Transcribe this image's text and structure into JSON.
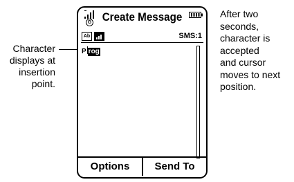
{
  "callouts": {
    "left": [
      "Character",
      "displays at",
      "insertion",
      "point."
    ],
    "right": [
      "After two",
      "seconds,",
      "character is",
      "accepted",
      "and cursor",
      "moves to next",
      "position."
    ]
  },
  "phone": {
    "title": "Create Message",
    "network_indicator": "G",
    "status": {
      "input_mode": "Ab",
      "sms_counter": "SMS:1"
    },
    "text": {
      "typed": "P",
      "suggestion": "rog"
    },
    "softkeys": {
      "left": "Options",
      "right": "Send To"
    }
  },
  "icons": [
    "signal-icon",
    "network-icon",
    "battery-icon",
    "input-mode-icon",
    "message-icon"
  ]
}
